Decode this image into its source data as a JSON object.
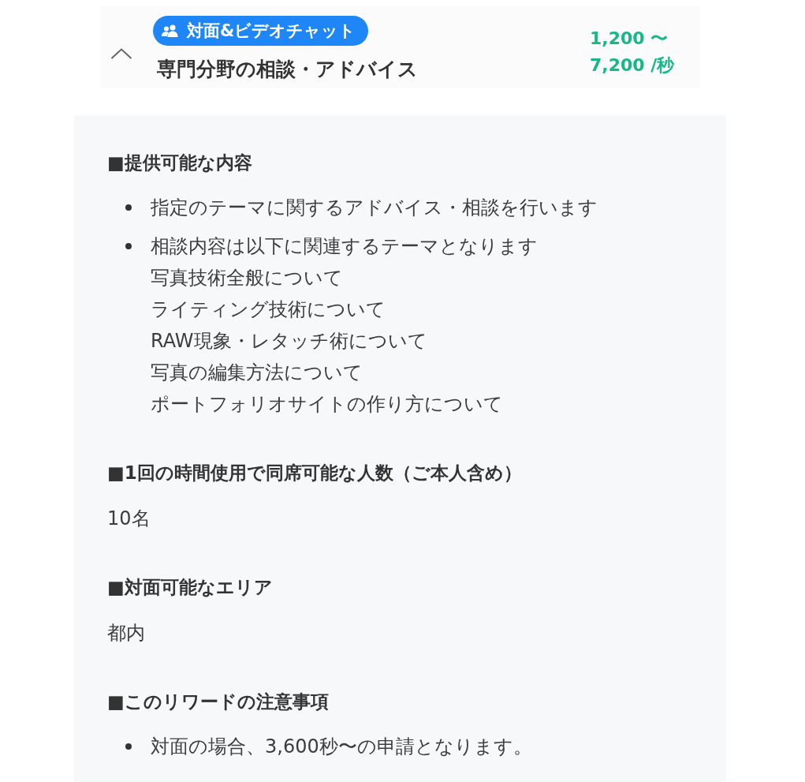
{
  "header": {
    "expanded": true,
    "badge": "対面&ビデオチャット",
    "title": "専門分野の相談・アドバイス",
    "price_lines": [
      "1,200 〜",
      "7,200 /秒"
    ]
  },
  "sections": [
    {
      "kind": "list",
      "heading": "■提供可能な内容",
      "items": [
        {
          "lines": [
            "指定のテーマに関するアドバイス・相談を行います"
          ]
        },
        {
          "lines": [
            "相談内容は以下に関連するテーマとなります",
            "写真技術全般について",
            "ライティング技術について",
            "RAW現象・レタッチ術について",
            "写真の編集方法について",
            "ポートフォリオサイトの作り方について"
          ]
        }
      ]
    },
    {
      "kind": "text",
      "heading": "■1回の時間使用で同席可能な人数（ご本人含め）",
      "text": "10名"
    },
    {
      "kind": "text",
      "heading": "■対面可能なエリア",
      "text": "都内"
    },
    {
      "kind": "list",
      "heading": "■このリワードの注意事項",
      "items": [
        {
          "lines": [
            "対面の場合、3,600秒〜の申請となります。"
          ]
        }
      ]
    }
  ]
}
